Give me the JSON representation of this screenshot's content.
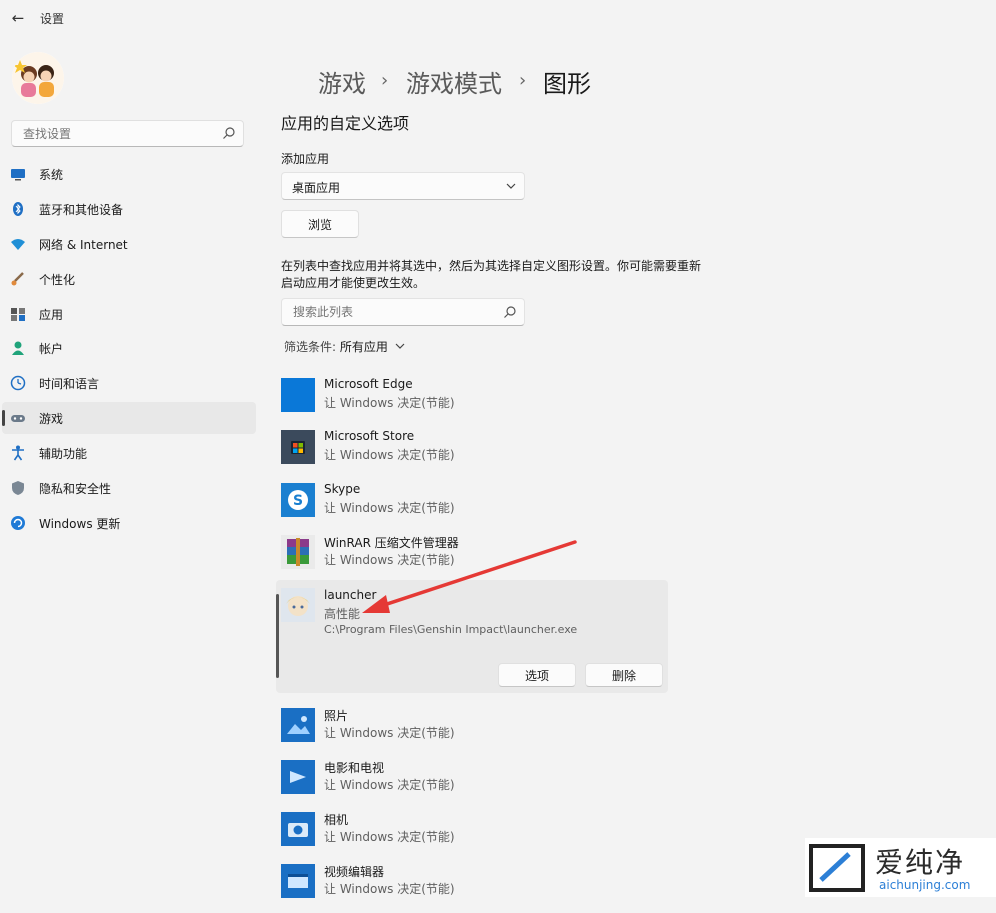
{
  "window": {
    "title": "设置"
  },
  "sidebar": {
    "search_placeholder": "查找设置",
    "items": [
      {
        "label": "系统",
        "icon": "monitor-icon"
      },
      {
        "label": "蓝牙和其他设备",
        "icon": "bluetooth-icon"
      },
      {
        "label": "网络 & Internet",
        "icon": "wifi-icon"
      },
      {
        "label": "个性化",
        "icon": "brush-icon"
      },
      {
        "label": "应用",
        "icon": "apps-icon"
      },
      {
        "label": "帐户",
        "icon": "person-icon"
      },
      {
        "label": "时间和语言",
        "icon": "globe-clock-icon"
      },
      {
        "label": "游戏",
        "icon": "gamepad-icon",
        "selected": true
      },
      {
        "label": "辅助功能",
        "icon": "accessibility-icon"
      },
      {
        "label": "隐私和安全性",
        "icon": "shield-icon"
      },
      {
        "label": "Windows 更新",
        "icon": "update-icon"
      }
    ]
  },
  "breadcrumb": {
    "items": [
      "游戏",
      "游戏模式",
      "图形"
    ],
    "separator": "›"
  },
  "main": {
    "section_title": "应用的自定义选项",
    "add_app_label": "添加应用",
    "app_type_value": "桌面应用",
    "browse_label": "浏览",
    "description": "在列表中查找应用并将其选中，然后为其选择自定义图形设置。你可能需要重新启动应用才能使更改生效。",
    "list_search_placeholder": "搜索此列表",
    "filter_label": "筛选条件:",
    "filter_value": "所有应用"
  },
  "apps": [
    {
      "name": "Microsoft Edge",
      "pref": "让 Windows 决定(节能)",
      "icon": "edge-icon"
    },
    {
      "name": "Microsoft Store",
      "pref": "让 Windows 决定(节能)",
      "icon": "store-icon"
    },
    {
      "name": "Skype",
      "pref": "让 Windows 决定(节能)",
      "icon": "skype-icon"
    },
    {
      "name": "WinRAR 压缩文件管理器",
      "pref": "让 Windows 决定(节能)",
      "icon": "winrar-icon"
    }
  ],
  "selected_app": {
    "name": "launcher",
    "pref": "高性能",
    "path": "C:\\Program Files\\Genshin Impact\\launcher.exe",
    "options_label": "选项",
    "delete_label": "删除",
    "icon": "character-icon"
  },
  "apps_after": [
    {
      "name": "照片",
      "pref": "让 Windows 决定(节能)",
      "icon": "photos-icon"
    },
    {
      "name": "电影和电视",
      "pref": "让 Windows 决定(节能)",
      "icon": "movies-icon"
    },
    {
      "name": "相机",
      "pref": "让 Windows 决定(节能)",
      "icon": "camera-icon"
    },
    {
      "name": "视频编辑器",
      "pref": "让 Windows 决定(节能)",
      "icon": "video-editor-icon"
    }
  ],
  "watermark": {
    "text": "爱纯净",
    "url": "aichunjing.com"
  },
  "colors": {
    "accent": "#0078d4",
    "annotation_arrow": "#e53935"
  }
}
